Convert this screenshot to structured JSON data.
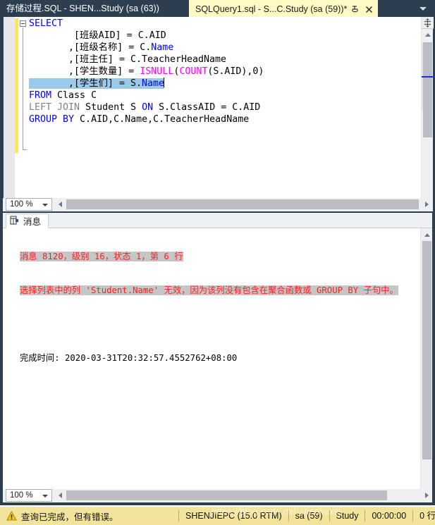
{
  "window": {
    "tabs": [
      {
        "id": "tab-stored-proc",
        "label": "存储过程.SQL - SHEN...Study (sa (63))",
        "active": false
      },
      {
        "id": "tab-sqlquery1",
        "label": "SQLQuery1.sql - S...C.Study (sa (59))*",
        "active": true
      }
    ],
    "overflow_icon": "chevron-down-icon",
    "pin_icon": "pin-icon",
    "close_icon": "close-icon"
  },
  "editor": {
    "zoom_label": "100 %",
    "code_lines": [
      {
        "id": "line-1",
        "tokens": [
          {
            "t": "SELECT",
            "c": "kw"
          }
        ]
      },
      {
        "id": "line-2",
        "tokens": [
          {
            "t": "        [班级AID] = ",
            "c": ""
          },
          {
            "t": "C",
            "c": ""
          },
          {
            "t": ".AID",
            "c": ""
          }
        ]
      },
      {
        "id": "line-3",
        "tokens": [
          {
            "t": "       ,[班级名称] = C.",
            "c": ""
          },
          {
            "t": "Name",
            "c": "id"
          }
        ]
      },
      {
        "id": "line-4",
        "tokens": [
          {
            "t": "       ,[班主任] = C.TeacherHeadName",
            "c": ""
          }
        ]
      },
      {
        "id": "line-5",
        "tokens": [
          {
            "t": "       ,[学生数量] = ",
            "c": ""
          },
          {
            "t": "ISNULL",
            "c": "fn"
          },
          {
            "t": "(",
            "c": ""
          },
          {
            "t": "COUNT",
            "c": "fn"
          },
          {
            "t": "(S.AID),0)",
            "c": ""
          }
        ]
      },
      {
        "id": "line-6",
        "selected": true,
        "tokens": [
          {
            "t": "       ,[学生们] = S.",
            "c": ""
          },
          {
            "t": "Name",
            "c": "id"
          }
        ]
      },
      {
        "id": "line-7",
        "tokens": [
          {
            "t": "FROM",
            "c": "kw"
          },
          {
            "t": " Class C",
            "c": ""
          }
        ]
      },
      {
        "id": "line-8",
        "tokens": [
          {
            "t": "LEFT JOIN",
            "c": "kwg"
          },
          {
            "t": " Student S ",
            "c": ""
          },
          {
            "t": "ON",
            "c": "kw"
          },
          {
            "t": " S.ClassAID = C.AID",
            "c": ""
          }
        ]
      },
      {
        "id": "line-9",
        "tokens": [
          {
            "t": "GROUP BY",
            "c": "kw"
          },
          {
            "t": " C.AID,C.Name,C.TeacherHeadName",
            "c": ""
          }
        ]
      }
    ]
  },
  "results": {
    "tab_label": "消息",
    "tab_icon": "messages-grid-icon",
    "zoom_label": "100 %",
    "messages": [
      {
        "id": "msg-error-header",
        "text": "消息 8120，级别 16，状态 1，第 6 行",
        "style": "error-highlight"
      },
      {
        "id": "msg-error-body",
        "text": "选择列表中的列 'Student.Name' 无效，因为该列没有包含在聚合函数或 GROUP BY 子句中。",
        "style": "error-highlight"
      },
      {
        "id": "msg-blank",
        "text": "",
        "style": "plain"
      },
      {
        "id": "msg-completion-time",
        "text": "完成时间: 2020-03-31T20:32:57.4552762+08:00",
        "style": "plain"
      }
    ]
  },
  "statusbar": {
    "warn_icon": "warning-icon",
    "status_text": "查询已完成，但有错误。",
    "server": "SHENJIEPC (15.0 RTM)",
    "user": "sa (59)",
    "database": "Study",
    "elapsed": "00:00:00",
    "rows": "0 行",
    "watermark": "https://blog.csdn.net/shenjiexsj"
  },
  "colors": {
    "tab_active_bg": "#fff9c4",
    "frame": "#2d3e50",
    "keyword": "#0000ff",
    "function": "#ff00ff",
    "keyword_gray": "#808080",
    "selection": "#9bc9ea",
    "change_bar": "#ffe74c",
    "error_text": "#ff2020",
    "status_bg": "#f2e49b"
  }
}
